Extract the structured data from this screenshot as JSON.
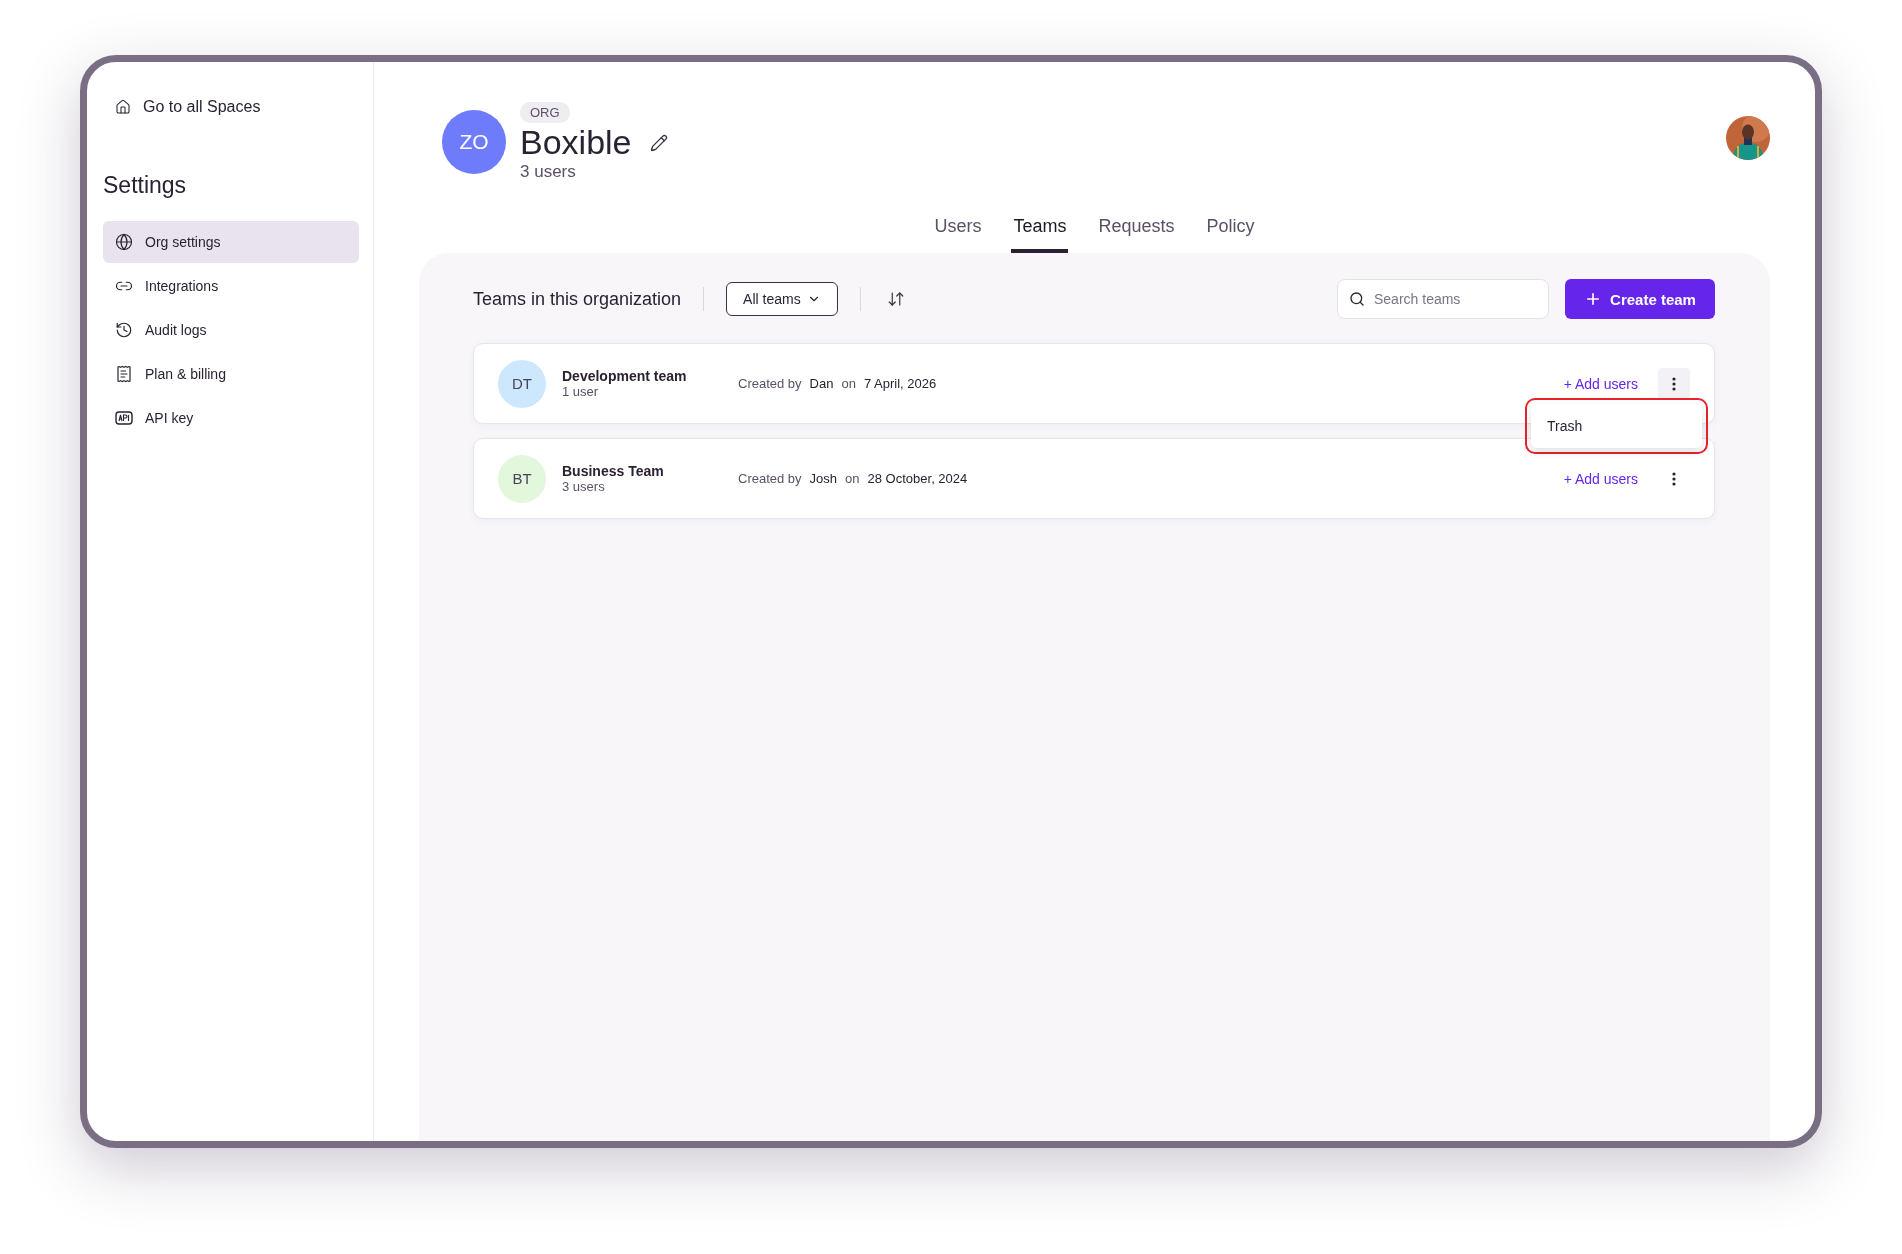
{
  "sidebar": {
    "back_link": "Go to all Spaces",
    "title": "Settings",
    "items": [
      {
        "label": "Org settings",
        "selected": true
      },
      {
        "label": "Integrations",
        "selected": false
      },
      {
        "label": "Audit logs",
        "selected": false
      },
      {
        "label": "Plan & billing",
        "selected": false
      },
      {
        "label": "API key",
        "selected": false
      }
    ]
  },
  "org": {
    "initials": "ZO",
    "badge": "ORG",
    "name": "Boxible",
    "users": "3 users"
  },
  "tabs": [
    {
      "label": "Users",
      "selected": false
    },
    {
      "label": "Teams",
      "selected": true
    },
    {
      "label": "Requests",
      "selected": false
    },
    {
      "label": "Policy",
      "selected": false
    }
  ],
  "toolbar": {
    "title": "Teams in this organization",
    "filter": "All teams",
    "search_placeholder": "Search teams",
    "create_button": "Create team"
  },
  "teams": [
    {
      "initials": "DT",
      "color": "#cde8fd",
      "name": "Development team",
      "users": "1 user",
      "created_by_label": "Created by",
      "creator": "Dan",
      "on_label": "on",
      "date": "7 April, 2026",
      "add_users": "+ Add users",
      "menu_open": true,
      "menu_items": [
        "Trash"
      ]
    },
    {
      "initials": "BT",
      "color": "#e3f7dc",
      "name": "Business Team",
      "users": "3 users",
      "created_by_label": "Created by",
      "creator": "Josh",
      "on_label": "on",
      "date": "28 October, 2024",
      "add_users": "+ Add users",
      "menu_open": false
    }
  ]
}
